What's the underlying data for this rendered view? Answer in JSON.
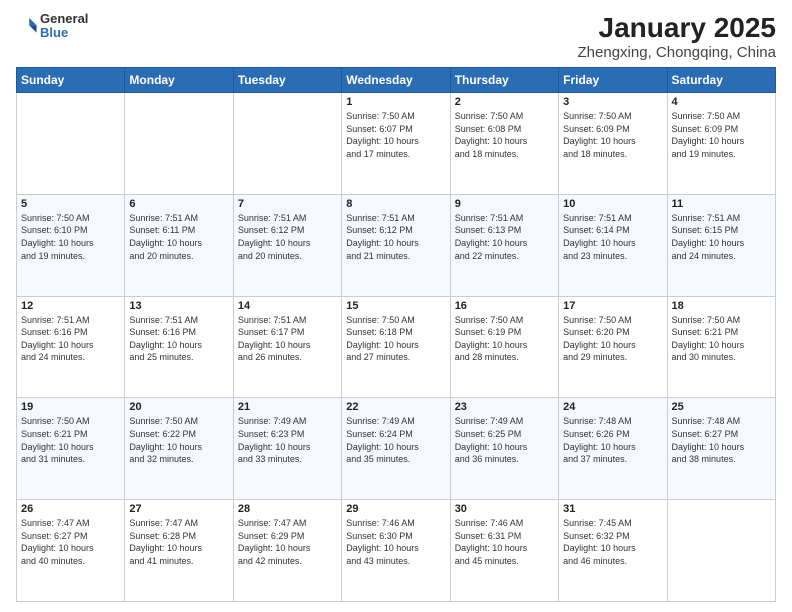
{
  "logo": {
    "general": "General",
    "blue": "Blue"
  },
  "title": "January 2025",
  "subtitle": "Zhengxing, Chongqing, China",
  "days_header": [
    "Sunday",
    "Monday",
    "Tuesday",
    "Wednesday",
    "Thursday",
    "Friday",
    "Saturday"
  ],
  "weeks": [
    [
      {
        "num": "",
        "info": ""
      },
      {
        "num": "",
        "info": ""
      },
      {
        "num": "",
        "info": ""
      },
      {
        "num": "1",
        "info": "Sunrise: 7:50 AM\nSunset: 6:07 PM\nDaylight: 10 hours\nand 17 minutes."
      },
      {
        "num": "2",
        "info": "Sunrise: 7:50 AM\nSunset: 6:08 PM\nDaylight: 10 hours\nand 18 minutes."
      },
      {
        "num": "3",
        "info": "Sunrise: 7:50 AM\nSunset: 6:09 PM\nDaylight: 10 hours\nand 18 minutes."
      },
      {
        "num": "4",
        "info": "Sunrise: 7:50 AM\nSunset: 6:09 PM\nDaylight: 10 hours\nand 19 minutes."
      }
    ],
    [
      {
        "num": "5",
        "info": "Sunrise: 7:50 AM\nSunset: 6:10 PM\nDaylight: 10 hours\nand 19 minutes."
      },
      {
        "num": "6",
        "info": "Sunrise: 7:51 AM\nSunset: 6:11 PM\nDaylight: 10 hours\nand 20 minutes."
      },
      {
        "num": "7",
        "info": "Sunrise: 7:51 AM\nSunset: 6:12 PM\nDaylight: 10 hours\nand 20 minutes."
      },
      {
        "num": "8",
        "info": "Sunrise: 7:51 AM\nSunset: 6:12 PM\nDaylight: 10 hours\nand 21 minutes."
      },
      {
        "num": "9",
        "info": "Sunrise: 7:51 AM\nSunset: 6:13 PM\nDaylight: 10 hours\nand 22 minutes."
      },
      {
        "num": "10",
        "info": "Sunrise: 7:51 AM\nSunset: 6:14 PM\nDaylight: 10 hours\nand 23 minutes."
      },
      {
        "num": "11",
        "info": "Sunrise: 7:51 AM\nSunset: 6:15 PM\nDaylight: 10 hours\nand 24 minutes."
      }
    ],
    [
      {
        "num": "12",
        "info": "Sunrise: 7:51 AM\nSunset: 6:16 PM\nDaylight: 10 hours\nand 24 minutes."
      },
      {
        "num": "13",
        "info": "Sunrise: 7:51 AM\nSunset: 6:16 PM\nDaylight: 10 hours\nand 25 minutes."
      },
      {
        "num": "14",
        "info": "Sunrise: 7:51 AM\nSunset: 6:17 PM\nDaylight: 10 hours\nand 26 minutes."
      },
      {
        "num": "15",
        "info": "Sunrise: 7:50 AM\nSunset: 6:18 PM\nDaylight: 10 hours\nand 27 minutes."
      },
      {
        "num": "16",
        "info": "Sunrise: 7:50 AM\nSunset: 6:19 PM\nDaylight: 10 hours\nand 28 minutes."
      },
      {
        "num": "17",
        "info": "Sunrise: 7:50 AM\nSunset: 6:20 PM\nDaylight: 10 hours\nand 29 minutes."
      },
      {
        "num": "18",
        "info": "Sunrise: 7:50 AM\nSunset: 6:21 PM\nDaylight: 10 hours\nand 30 minutes."
      }
    ],
    [
      {
        "num": "19",
        "info": "Sunrise: 7:50 AM\nSunset: 6:21 PM\nDaylight: 10 hours\nand 31 minutes."
      },
      {
        "num": "20",
        "info": "Sunrise: 7:50 AM\nSunset: 6:22 PM\nDaylight: 10 hours\nand 32 minutes."
      },
      {
        "num": "21",
        "info": "Sunrise: 7:49 AM\nSunset: 6:23 PM\nDaylight: 10 hours\nand 33 minutes."
      },
      {
        "num": "22",
        "info": "Sunrise: 7:49 AM\nSunset: 6:24 PM\nDaylight: 10 hours\nand 35 minutes."
      },
      {
        "num": "23",
        "info": "Sunrise: 7:49 AM\nSunset: 6:25 PM\nDaylight: 10 hours\nand 36 minutes."
      },
      {
        "num": "24",
        "info": "Sunrise: 7:48 AM\nSunset: 6:26 PM\nDaylight: 10 hours\nand 37 minutes."
      },
      {
        "num": "25",
        "info": "Sunrise: 7:48 AM\nSunset: 6:27 PM\nDaylight: 10 hours\nand 38 minutes."
      }
    ],
    [
      {
        "num": "26",
        "info": "Sunrise: 7:47 AM\nSunset: 6:27 PM\nDaylight: 10 hours\nand 40 minutes."
      },
      {
        "num": "27",
        "info": "Sunrise: 7:47 AM\nSunset: 6:28 PM\nDaylight: 10 hours\nand 41 minutes."
      },
      {
        "num": "28",
        "info": "Sunrise: 7:47 AM\nSunset: 6:29 PM\nDaylight: 10 hours\nand 42 minutes."
      },
      {
        "num": "29",
        "info": "Sunrise: 7:46 AM\nSunset: 6:30 PM\nDaylight: 10 hours\nand 43 minutes."
      },
      {
        "num": "30",
        "info": "Sunrise: 7:46 AM\nSunset: 6:31 PM\nDaylight: 10 hours\nand 45 minutes."
      },
      {
        "num": "31",
        "info": "Sunrise: 7:45 AM\nSunset: 6:32 PM\nDaylight: 10 hours\nand 46 minutes."
      },
      {
        "num": "",
        "info": ""
      }
    ]
  ]
}
